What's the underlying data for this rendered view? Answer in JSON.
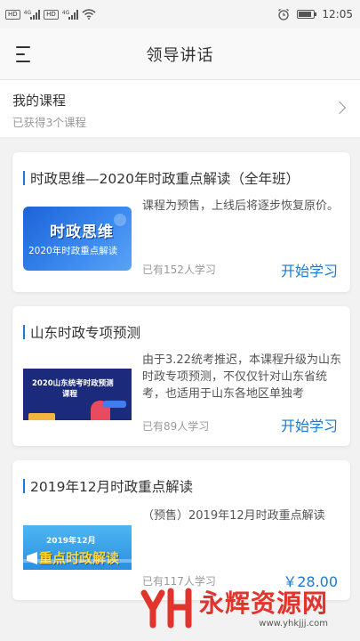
{
  "statusbar": {
    "sim1": "HD",
    "sim2": "HD",
    "net1": "4G",
    "net2": "4G",
    "time": "12:05",
    "alarm_icon": "alarm-icon",
    "wifi_icon": "wifi-icon",
    "battery_icon": "battery-icon"
  },
  "navbar": {
    "title": "领导讲话",
    "menu_icon": "menu-icon"
  },
  "my_courses": {
    "title": "我的课程",
    "subtitle": "已获得3个课程",
    "chevron_icon": "chevron-right-icon"
  },
  "accent_color": "#1a7ad4",
  "courses": [
    {
      "title": "时政思维—2020年时政重点解读（全年班）",
      "thumb_title": "时政思维",
      "thumb_subtitle": "2020年时政重点解读",
      "description": "课程为预售，上线后将逐步恢复原价。",
      "learners": "已有152人学习",
      "action": "开始学习"
    },
    {
      "title": "山东时政专项预测",
      "thumb_title": "2020山东统考时政预测",
      "thumb_subtitle": "课程",
      "description": "由于3.22统考推迟，本课程升级为山东时政专项预测，不仅仅针对山东省统考，也适用于山东各地区单独考",
      "learners": "已有89人学习",
      "action": "开始学习"
    },
    {
      "title": "2019年12月时政重点解读",
      "thumb_title": "2019年12月",
      "thumb_subtitle": "重点时政解读",
      "description": "（预售）2019年12月时政重点解读",
      "learners": "已有117人学习",
      "action": "￥28.00"
    }
  ],
  "watermark": {
    "brand": "永辉资源网",
    "url": "www.yhkjjj.com"
  }
}
